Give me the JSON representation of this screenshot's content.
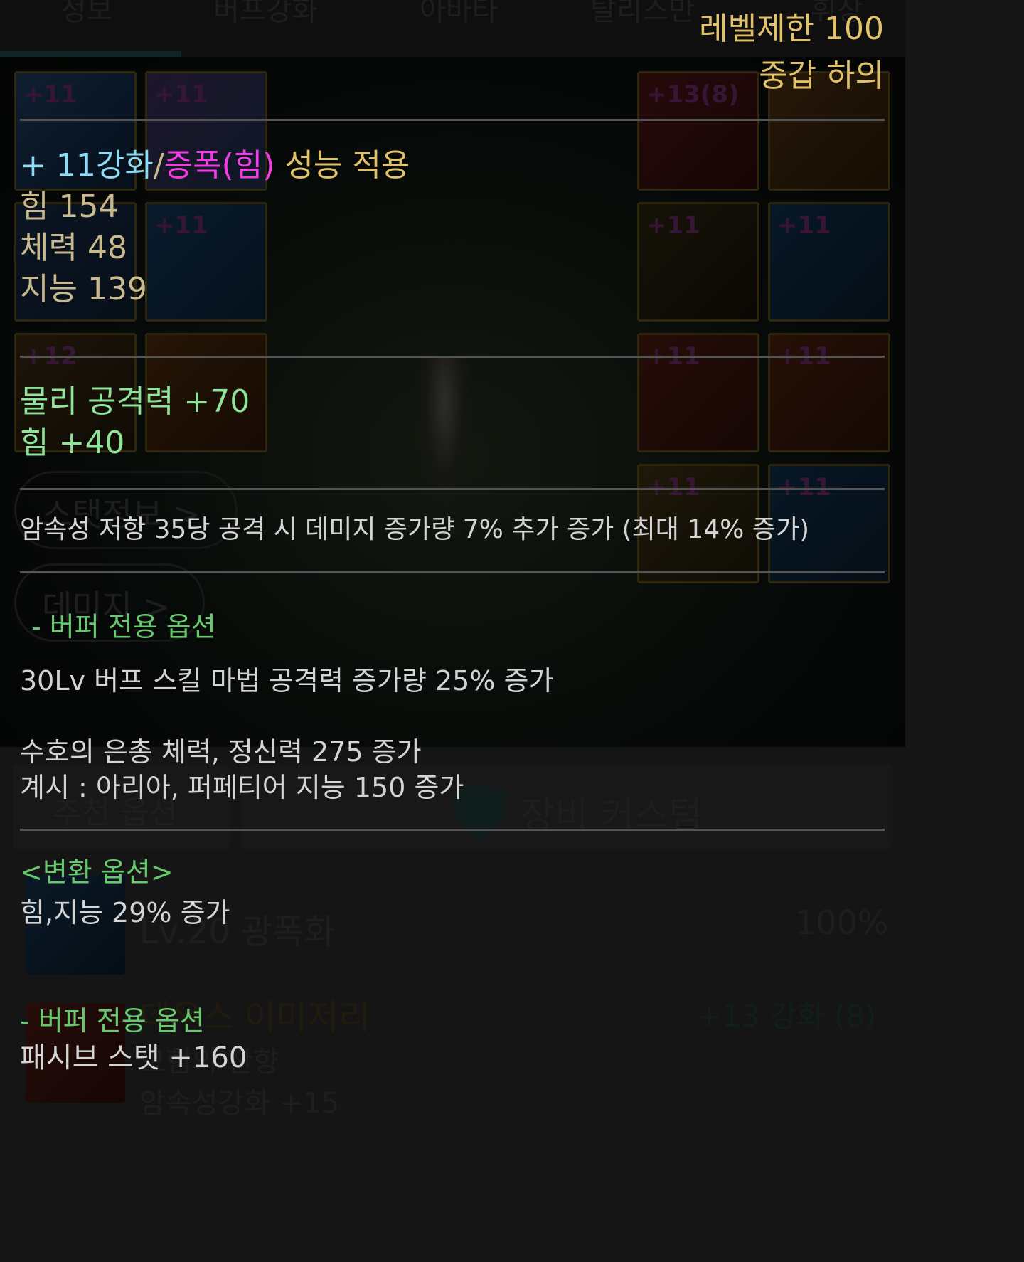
{
  "header": {
    "level_limit": "레벨제한 100",
    "item_type": "중갑 하의"
  },
  "enhance": {
    "plus_label": "+ 11강화",
    "sep": "/",
    "amp_label": "증폭(힘)",
    "applied_label": "성능 적용"
  },
  "base_stats": [
    "힘 154",
    "체력 48",
    "지능 139"
  ],
  "bonus_stats": [
    "물리 공격력 +70",
    "힘 +40"
  ],
  "effect_text": "암속성 저항 35당 공격 시 데미지 증가량 7% 추가 증가 (최대 14% 증가)",
  "buffer_section": {
    "title": "- 버퍼 전용 옵션",
    "line1": "30Lv 버프 스킬 마법 공격력 증가량 25% 증가",
    "line2": "수호의 은총 체력, 정신력 275 증가",
    "line3": "계시 : 아리아, 퍼페티어 지능 150 증가"
  },
  "conversion": {
    "title": "<변환 옵션>",
    "line": "힘,지능 29% 증가",
    "buffer_title": "- 버퍼 전용 옵션",
    "buffer_line": "패시브 스탯 +160"
  },
  "background": {
    "tabs": [
      "정보",
      "버프강화",
      "아바타",
      "탈리스만",
      "휘장"
    ],
    "slot_levels": [
      "+11",
      "+11",
      "+13(8)",
      "+11",
      "+11",
      "+11",
      "+12",
      "+11",
      "+11",
      "+11",
      "+11"
    ],
    "stat_button": "스탯정보 >",
    "damage_button": "데미지 >",
    "recommend_tab": "추천 옵션",
    "custom_tab": "장비 커스텀",
    "row1_name": "Lv.20 광폭화",
    "row1_value": "100%",
    "row2_name": "데우스 이미저리",
    "row2_value": "+13 강화 (8)",
    "row2_sub1": "모험의 잔향",
    "row2_sub2": "암속성강화 +15"
  }
}
